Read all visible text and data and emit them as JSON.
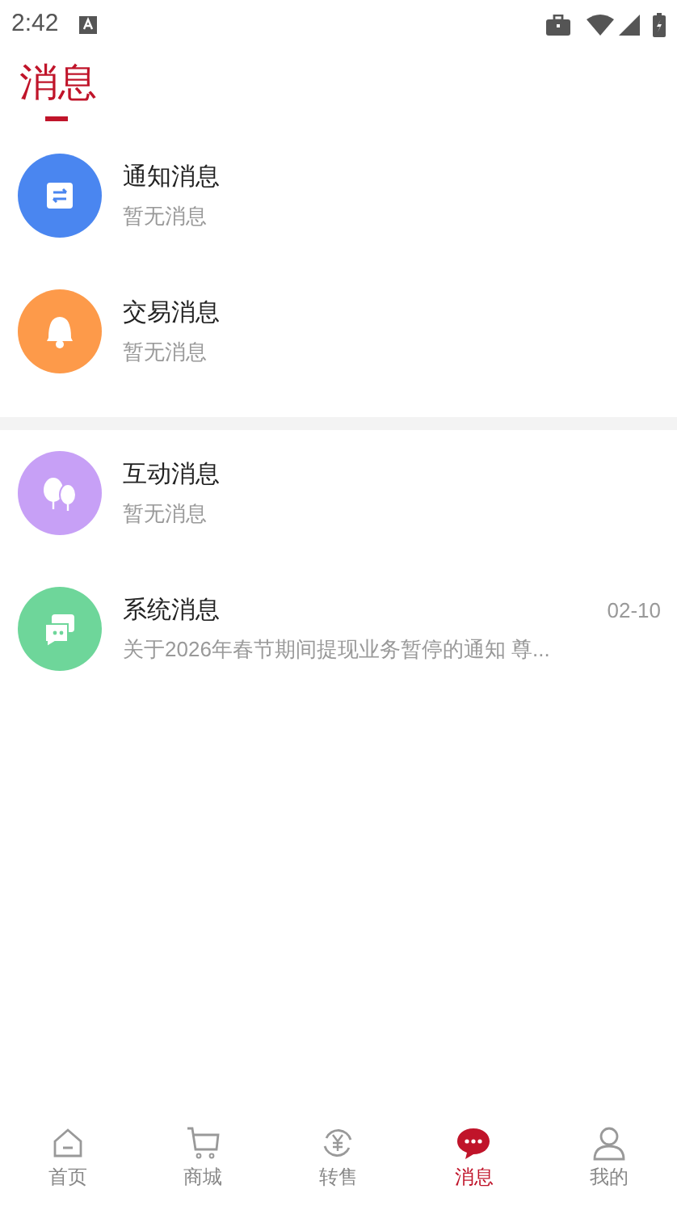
{
  "status_bar": {
    "time": "2:42"
  },
  "header": {
    "title": "消息"
  },
  "groups": [
    {
      "items": [
        {
          "kind": "notice",
          "color": "#4a86f0",
          "title": "通知消息",
          "preview": "暂无消息"
        },
        {
          "kind": "trade",
          "color": "#fd9a4a",
          "title": "交易消息",
          "preview": "暂无消息"
        }
      ]
    },
    {
      "items": [
        {
          "kind": "interact",
          "color": "#c7a0f6",
          "title": "互动消息",
          "preview": "暂无消息"
        },
        {
          "kind": "system",
          "color": "#6ed69a",
          "title": "系统消息",
          "preview": "关于2026年春节期间提现业务暂停的通知 尊...",
          "date": "02-10"
        }
      ]
    }
  ],
  "tab_bar": [
    {
      "kind": "home",
      "label": "首页",
      "selected": false
    },
    {
      "kind": "mall",
      "label": "商城",
      "selected": false
    },
    {
      "kind": "resale",
      "label": "转售",
      "selected": false
    },
    {
      "kind": "messages",
      "label": "消息",
      "selected": true
    },
    {
      "kind": "me",
      "label": "我的",
      "selected": false
    }
  ]
}
